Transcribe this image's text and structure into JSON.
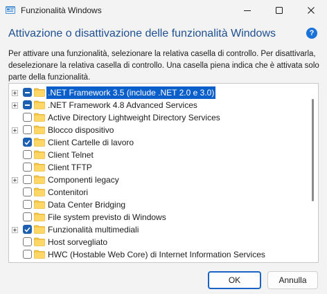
{
  "window": {
    "title": "Funzionalità Windows",
    "icon": "windows-features-icon",
    "controls": [
      "minimize-icon",
      "maximize-icon",
      "close-icon"
    ]
  },
  "heading": "Attivazione o disattivazione delle funzionalità Windows",
  "help_label": "?",
  "description": "Per attivare una funzionalità, selezionare la relativa casella di controllo. Per disattivarla, deselezionare la relativa casella di controllo. Una casella piena indica che è attivata solo parte della funzionalità.",
  "features": [
    {
      "label": ".NET Framework 3.5 (include .NET 2.0 e 3.0)",
      "expandable": true,
      "state": "partial",
      "selected": true
    },
    {
      "label": ".NET Framework 4.8 Advanced Services",
      "expandable": true,
      "state": "partial",
      "selected": false
    },
    {
      "label": "Active Directory Lightweight Directory Services",
      "expandable": false,
      "state": "unchecked",
      "selected": false
    },
    {
      "label": "Blocco dispositivo",
      "expandable": true,
      "state": "unchecked",
      "selected": false
    },
    {
      "label": "Client Cartelle di lavoro",
      "expandable": false,
      "state": "checked",
      "selected": false
    },
    {
      "label": "Client Telnet",
      "expandable": false,
      "state": "unchecked",
      "selected": false
    },
    {
      "label": "Client TFTP",
      "expandable": false,
      "state": "unchecked",
      "selected": false
    },
    {
      "label": "Componenti legacy",
      "expandable": true,
      "state": "unchecked",
      "selected": false
    },
    {
      "label": "Contenitori",
      "expandable": false,
      "state": "unchecked",
      "selected": false
    },
    {
      "label": "Data Center Bridging",
      "expandable": false,
      "state": "unchecked",
      "selected": false
    },
    {
      "label": "File system previsto di Windows",
      "expandable": false,
      "state": "unchecked",
      "selected": false
    },
    {
      "label": "Funzionalità multimediali",
      "expandable": true,
      "state": "checked",
      "selected": false
    },
    {
      "label": "Host sorvegliato",
      "expandable": false,
      "state": "unchecked",
      "selected": false
    },
    {
      "label": "HWC (Hostable Web Core) di Internet Information Services",
      "expandable": false,
      "state": "unchecked",
      "selected": false
    }
  ],
  "buttons": {
    "ok": "OK",
    "cancel": "Annulla"
  },
  "colors": {
    "accent": "#1d5fb0",
    "heading": "#1d4f91",
    "selection": "#0b5fca",
    "folder": "#f4c64a"
  }
}
